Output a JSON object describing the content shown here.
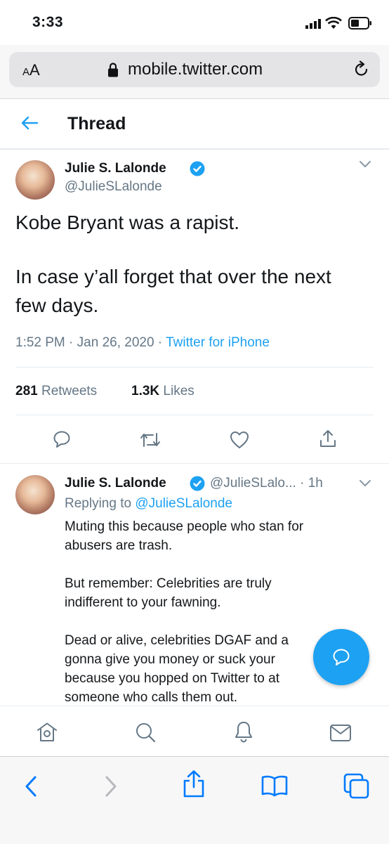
{
  "status_bar": {
    "time": "3:33"
  },
  "browser": {
    "aa_label_big": "A",
    "aa_label_small": "A",
    "url": "mobile.twitter.com"
  },
  "header": {
    "title": "Thread"
  },
  "tweet": {
    "name": "Julie S. Lalonde",
    "handle": "@JulieSLalonde",
    "text_line1": "Kobe Bryant was a rapist.",
    "text_line2": "In case y’all forget that over the next",
    "text_line3": "few days.",
    "time": "1:52 PM",
    "date": "Jan 26, 2020",
    "source": "Twitter for iPhone",
    "retweets_count": "281",
    "retweets_label": "Retweets",
    "likes_count": "1.3K",
    "likes_label": "Likes"
  },
  "reply": {
    "name": "Julie S. Lalonde",
    "handle": "@JulieSLalo...",
    "age": "1h",
    "replying_prefix": "Replying to",
    "replying_to": "@JulieSLalonde",
    "line1": "Muting this because people who stan for",
    "line2": "abusers are trash.",
    "line3": "But remember: Celebrities are truly",
    "line4": "indifferent to your fawning.",
    "line5": "Dead or alive, celebrities DGAF and a",
    "line6": "gonna give you money or suck your",
    "line7": "because you hopped on Twitter to at",
    "line8": "someone who calls them out."
  },
  "colors": {
    "accent": "#1da1f2",
    "verified": "#1da1f2",
    "secondary_text": "#657786",
    "ios_blue": "#007aff"
  }
}
